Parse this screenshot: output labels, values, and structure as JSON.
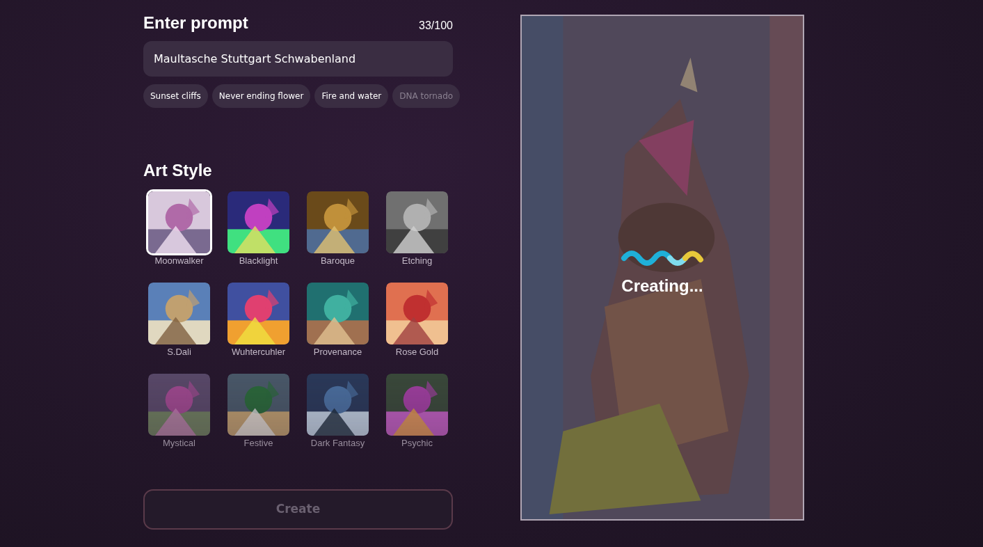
{
  "prompt": {
    "title": "Enter prompt",
    "counter": "33/100",
    "value": "Maultasche Stuttgart Schwabenland"
  },
  "suggestions": [
    "Sunset cliffs",
    "Never ending flower",
    "Fire and water",
    "DNA tornado"
  ],
  "art_style": {
    "title": "Art Style",
    "styles": [
      {
        "label": "Moonwalker",
        "selected": true
      },
      {
        "label": "Blacklight",
        "selected": false
      },
      {
        "label": "Baroque",
        "selected": false
      },
      {
        "label": "Etching",
        "selected": false
      },
      {
        "label": "S.Dali",
        "selected": false
      },
      {
        "label": "Wuhtercuhler",
        "selected": false
      },
      {
        "label": "Provenance",
        "selected": false
      },
      {
        "label": "Rose Gold",
        "selected": false
      },
      {
        "label": "Mystical",
        "selected": false
      },
      {
        "label": "Festive",
        "selected": false
      },
      {
        "label": "Dark Fantasy",
        "selected": false
      },
      {
        "label": "Psychic",
        "selected": false
      }
    ]
  },
  "create_button": {
    "label": "Create",
    "disabled": true
  },
  "preview": {
    "status": "Creating..."
  }
}
